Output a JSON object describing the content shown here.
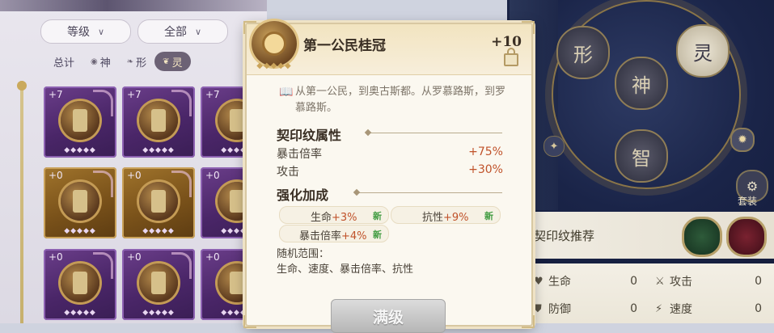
{
  "filters": {
    "grade": "等级",
    "scope": "全部"
  },
  "categories": [
    {
      "label": "总计",
      "icon": ""
    },
    {
      "label": "神",
      "icon": "◉"
    },
    {
      "label": "形",
      "icon": "❧"
    },
    {
      "label": "灵",
      "icon": "❦"
    }
  ],
  "inventory": [
    {
      "level": "+7",
      "tier": "purple"
    },
    {
      "level": "+7",
      "tier": "purple"
    },
    {
      "level": "+7",
      "tier": "purple"
    },
    {
      "level": "+0",
      "tier": "gold"
    },
    {
      "level": "+0",
      "tier": "gold"
    },
    {
      "level": "+0",
      "tier": "purple"
    },
    {
      "level": "+0",
      "tier": "purple"
    },
    {
      "level": "+0",
      "tier": "purple"
    },
    {
      "level": "+0",
      "tier": "purple"
    }
  ],
  "popup": {
    "title": "第一公民桂冠",
    "level": "+10",
    "description": "从第一公民，到奥古斯都。从罗慕路斯，到罗慕路斯。",
    "section_attr_title": "契印纹属性",
    "attributes": [
      {
        "name": "暴击倍率",
        "value": "+75%"
      },
      {
        "name": "攻击",
        "value": "+30%"
      }
    ],
    "section_enh_title": "强化加成",
    "enhancements": [
      {
        "name": "生命",
        "value": "+3%",
        "tag": "新"
      },
      {
        "name": "抗性",
        "value": "+9%",
        "tag": "新"
      },
      {
        "name": "暴击倍率",
        "value": "+4%",
        "tag": "新"
      }
    ],
    "range_label": "随机范围：",
    "range_text": "生命、速度、暴击倍率、抗性",
    "max_button": "满级"
  },
  "dial": {
    "nodes": [
      "形",
      "灵",
      "神",
      "智"
    ]
  },
  "suit_label": "套装",
  "recommend": {
    "title": "契印纹推荐"
  },
  "stats": [
    {
      "label": "生命",
      "value": "0",
      "icon": "♥"
    },
    {
      "label": "攻击",
      "value": "0",
      "icon": "⚔"
    },
    {
      "label": "防御",
      "value": "0",
      "icon": "⛊"
    },
    {
      "label": "速度",
      "value": "0",
      "icon": "⚡"
    }
  ],
  "colors": {
    "accent_value": "#c0522a",
    "new_tag": "#3e9a3e",
    "popup_bg": "#fbf8f0",
    "header_gold": "#f2e4c0",
    "inv_purple": "#4a2668",
    "inv_gold": "#7a521a"
  }
}
